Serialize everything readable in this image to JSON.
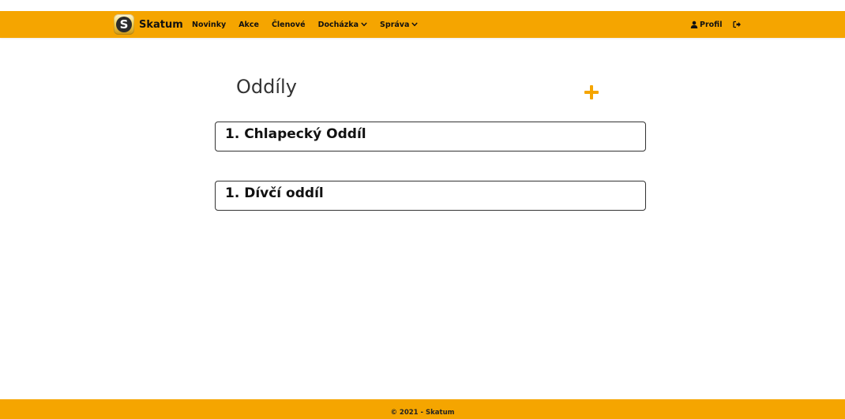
{
  "brand": {
    "logo_letter": "S",
    "name": "Skatum"
  },
  "nav": {
    "items": [
      {
        "label": "Novinky",
        "dropdown": false
      },
      {
        "label": "Akce",
        "dropdown": false
      },
      {
        "label": "Členové",
        "dropdown": false
      },
      {
        "label": "Docházka",
        "dropdown": true
      },
      {
        "label": "Správa",
        "dropdown": true
      }
    ],
    "profile_label": "Profil",
    "profile_icon": "user-icon",
    "logout_icon": "sign-out-icon"
  },
  "main": {
    "title": "Oddíly",
    "add_icon": "plus-icon",
    "units": [
      {
        "name": "1. Chlapecký Oddíl"
      },
      {
        "name": "1. Dívčí oddíl"
      }
    ]
  },
  "footer": {
    "text": "© 2021 - Skatum"
  },
  "colors": {
    "accent": "#f5a500",
    "text": "#111111"
  }
}
